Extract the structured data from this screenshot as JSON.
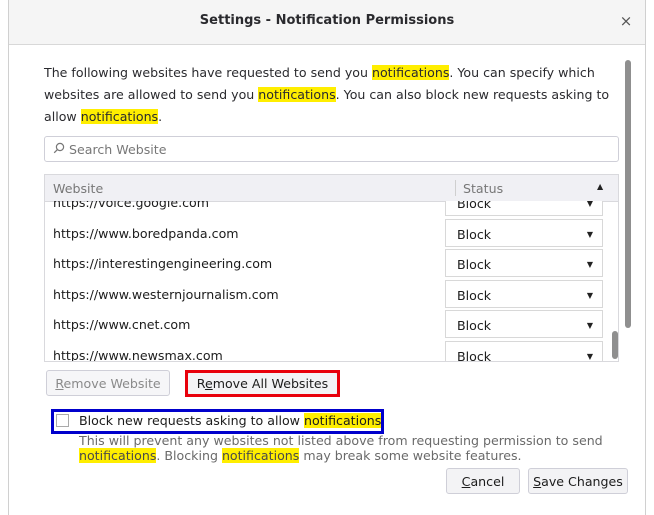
{
  "dialog": {
    "title": "Settings - Notification Permissions",
    "close_glyph": "×"
  },
  "description": {
    "part1": "The following websites have requested to send you ",
    "hl1": "notifications",
    "part2": ". You can specify which websites are allowed to send you ",
    "hl2": "notifications",
    "part3": ". You can also block new requests asking to allow ",
    "hl3": "notifications",
    "part4": "."
  },
  "search": {
    "placeholder": "Search Website",
    "value": "",
    "icon": "search-icon"
  },
  "table": {
    "headers": {
      "website": "Website",
      "status": "Status"
    },
    "sort_icon": "sort-up-icon",
    "rows": [
      {
        "website": "https://voice.google.com",
        "status": "Block"
      },
      {
        "website": "https://www.boredpanda.com",
        "status": "Block"
      },
      {
        "website": "https://interestingengineering.com",
        "status": "Block"
      },
      {
        "website": "https://www.westernjournalism.com",
        "status": "Block"
      },
      {
        "website": "https://www.cnet.com",
        "status": "Block"
      },
      {
        "website": "https://www.newsmax.com",
        "status": "Block"
      }
    ]
  },
  "buttons": {
    "remove_website": {
      "access": "R",
      "rest": "emove Website"
    },
    "remove_all": {
      "first": "R",
      "access": "e",
      "rest": "move All Websites"
    },
    "cancel": {
      "access": "C",
      "rest": "ancel"
    },
    "save": {
      "access": "S",
      "rest": "ave Changes"
    }
  },
  "block_requests": {
    "checked": false,
    "label_text": "Block new requests asking to allow ",
    "label_hl": "notifications"
  },
  "note": {
    "part1": "This will prevent any websites not listed above from requesting permission to send ",
    "hl1": "notifications",
    "part2": ". Blocking ",
    "hl2": "notifications",
    "part3": " may break some website features."
  },
  "annotation_colors": {
    "red_box": "#e8000b",
    "blue_box": "#0000cc",
    "highlight": "#ffee00"
  }
}
